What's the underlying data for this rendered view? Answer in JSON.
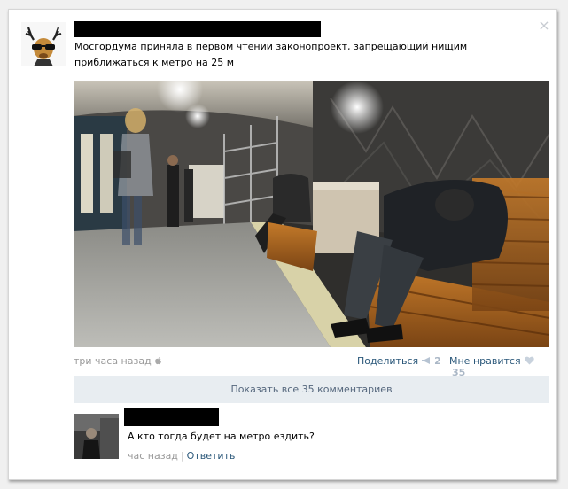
{
  "post": {
    "text": "Мосгордума приняла в первом чтении законопроект, запрещающий нищим приближаться к метро на 25 м",
    "time": "три часа назад",
    "share_label": "Поделиться",
    "share_count": "2",
    "like_label": "Мне нравится",
    "like_count": "35",
    "show_all_comments": "Показать все 35 комментариев",
    "close_icon": "close-icon",
    "platform_icon": "apple-icon"
  },
  "comment": {
    "text": "А кто тогда будет на метро ездить?",
    "time": "час назад",
    "separator": "|",
    "reply_label": "Ответить"
  },
  "colors": {
    "link": "#2b587a",
    "muted": "#999999",
    "button_bg": "#e8edf1",
    "button_text": "#55677d",
    "count": "#aab7c6"
  }
}
